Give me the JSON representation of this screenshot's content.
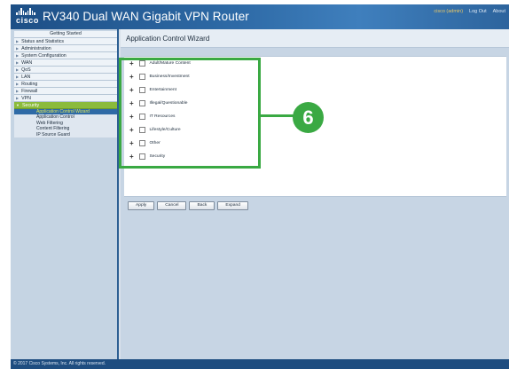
{
  "header": {
    "logo_text": "cisco",
    "title": "RV340 Dual WAN Gigabit VPN Router",
    "user": "cisco (admin)",
    "logout": "Log Out",
    "about": "About"
  },
  "sidebar": {
    "items": [
      {
        "label": "Getting Started",
        "arrow": ""
      },
      {
        "label": "Status and Statistics",
        "arrow": "▶"
      },
      {
        "label": "Administration",
        "arrow": "▶"
      },
      {
        "label": "System Configuration",
        "arrow": "▶"
      },
      {
        "label": "WAN",
        "arrow": "▶"
      },
      {
        "label": "QoS",
        "arrow": "▶"
      },
      {
        "label": "LAN",
        "arrow": "▶"
      },
      {
        "label": "Routing",
        "arrow": "▶"
      },
      {
        "label": "Firewall",
        "arrow": "▶"
      },
      {
        "label": "VPN",
        "arrow": "▶"
      },
      {
        "label": "Security",
        "arrow": "▼"
      }
    ],
    "security_sub": [
      "Application Control Wizard",
      "Application Control",
      "Web Filtering",
      "Content Filtering",
      "IP Source Guard"
    ]
  },
  "main": {
    "page_title": "Application Control Wizard",
    "categories": [
      "Adult/Mature Content",
      "Business/Investment",
      "Entertainment",
      "Illegal/Questionable",
      "IT Resources",
      "Lifestyle/Culture",
      "Other",
      "Security"
    ],
    "expand_symbol": "+",
    "buttons": {
      "apply": "Apply",
      "cancel": "Cancel",
      "back": "Back",
      "expand": "Expand"
    }
  },
  "callout": {
    "step": "6",
    "color": "#3aa943"
  },
  "footer": {
    "copyright": "© 2017 Cisco Systems, Inc. All rights reserved."
  },
  "colors": {
    "header_blue": "#2e6aa6",
    "active_green": "#8bbb3c",
    "selected_text": "#e2e95a"
  }
}
